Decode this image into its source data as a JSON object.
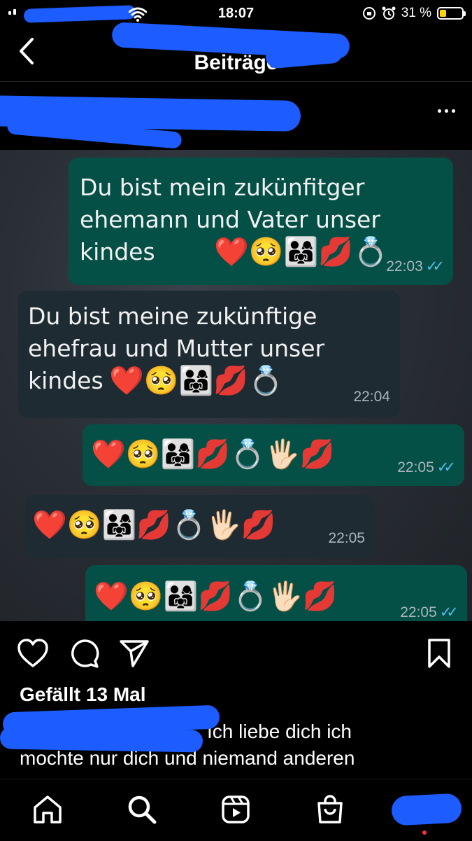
{
  "status": {
    "time": "18:07",
    "battery": "31 %",
    "battery_level": 0.31,
    "battery_color": "#ffd60a"
  },
  "nav": {
    "title": "Beiträge"
  },
  "post": {
    "messages": [
      {
        "side": "out",
        "text": "Du bist mein zukünfitger ehemann und Vater unser kindes",
        "emojis": "❤️🥺👨‍👩‍👧💋💍",
        "time": "22:03"
      },
      {
        "side": "in",
        "text": "Du bist meine zukünftige ehefrau und Mutter unser kindes",
        "emojis": "❤️🥺👨‍👩‍👧💋💍",
        "time": "22:04"
      },
      {
        "side": "out",
        "text": "",
        "emojis": "❤️🥺👨‍👩‍👧💋💍🖐🏻💋",
        "time": "22:05"
      },
      {
        "side": "in",
        "text": "",
        "emojis": "❤️🥺👨‍👩‍👧💋💍🖐🏻💋",
        "time": "22:05"
      },
      {
        "side": "out",
        "text": "",
        "emojis": "❤️🥺👨‍👩‍👧💋💍🖐🏻💋",
        "time": "22:05"
      }
    ],
    "likes": "Gefällt 13 Mal",
    "caption_line1": "Ich liebe dich ich",
    "caption_line2": "mochte nur dich und niemand anderen"
  },
  "icons": {
    "back": "chevron-left-icon",
    "more": "more-horizontal-icon",
    "like": "heart-icon",
    "comment": "comment-icon",
    "share": "send-icon",
    "save": "bookmark-icon",
    "home": "home-icon",
    "search": "search-icon",
    "reels": "reels-icon",
    "shop": "shopping-bag-icon"
  },
  "colors": {
    "outgoing_bubble": "#055046",
    "incoming_bubble": "#1e2b33",
    "read_ticks": "#53bdeb",
    "redaction": "#1d5cff"
  }
}
